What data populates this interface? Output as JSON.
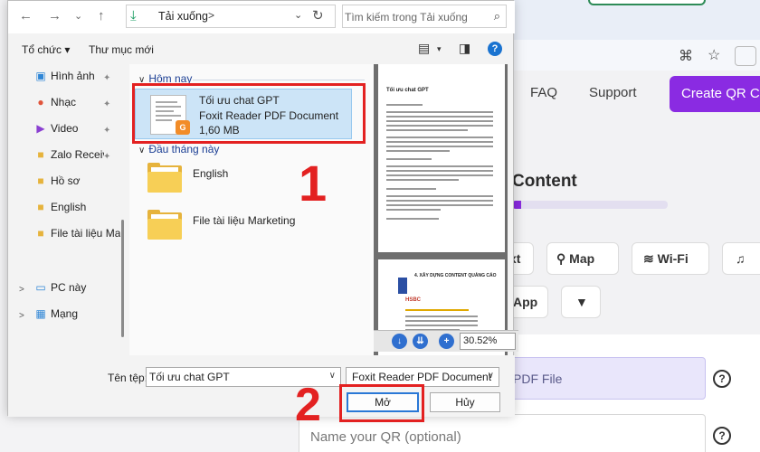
{
  "background_site": {
    "nav": {
      "faq": "FAQ",
      "support": "Support"
    },
    "create_button": "Create QR Cod",
    "heading": "Content",
    "progress": 0.06,
    "qr_types": {
      "text": "xt",
      "map": "Map",
      "wifi": "Wi-Fi",
      "app": "App"
    },
    "upload_field": "PDF File",
    "name_placeholder": "Name your QR (optional)",
    "help": "?",
    "accent": "#8a2be2"
  },
  "dialog": {
    "address": {
      "crumb": "Tải xuống",
      "crumb_sep": ">",
      "search_placeholder": "Tìm kiếm trong Tải xuống"
    },
    "toolbar": {
      "organize": "Tổ chức ▾",
      "new_folder": "Thư mục mới",
      "help": "?"
    },
    "nav": {
      "items": [
        {
          "label": "Hình ảnh",
          "icon": "pictures-icon"
        },
        {
          "label": "Nhạc",
          "icon": "music-icon"
        },
        {
          "label": "Video",
          "icon": "video-icon"
        },
        {
          "label": "Zalo Receive",
          "icon": "folder-icon"
        },
        {
          "label": "Hồ sơ",
          "icon": "folder-icon"
        },
        {
          "label": "English",
          "icon": "folder-icon"
        },
        {
          "label": "File tài liệu Mar",
          "icon": "folder-icon"
        },
        {
          "label": "PC này",
          "icon": "pc-icon"
        },
        {
          "label": "Mạng",
          "icon": "network-icon"
        }
      ]
    },
    "groups": {
      "today": "Hôm nay",
      "early_month": "Đầu tháng này"
    },
    "selected_file": {
      "name": "Tối ưu chat GPT",
      "type": "Foxit Reader PDF Document",
      "size": "1,60 MB"
    },
    "folders": [
      "English",
      "File tài liệu Marketing"
    ],
    "preview": {
      "page_title": "Tối ưu chat GPT",
      "page2_heading": "4. XÂY DỰNG CONTENT QUẢNG CÁO",
      "page2_logo": "HSBC",
      "zoom": "30.52%"
    },
    "bottom": {
      "filename_label": "Tên tệp:",
      "filename_value": "Tối ưu chat GPT",
      "filetype": "Foxit Reader PDF Document",
      "open": "Mở",
      "cancel": "Hủy"
    }
  },
  "annotations": {
    "step1": "1",
    "step2": "2",
    "color": "#e32121"
  }
}
